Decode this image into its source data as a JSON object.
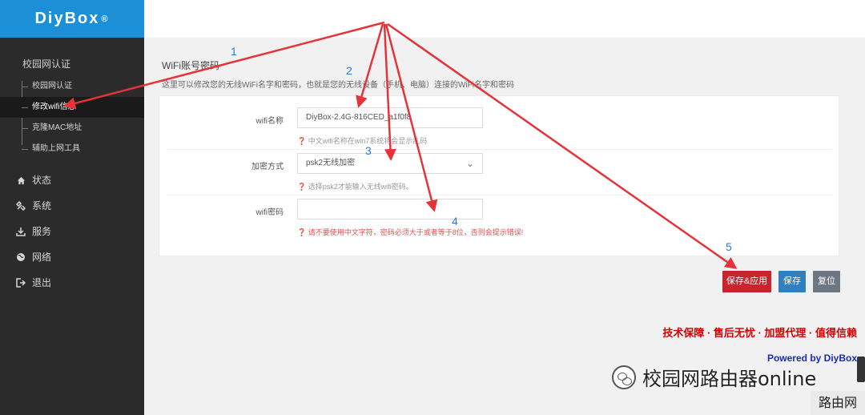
{
  "brand": {
    "name": "DiyBox",
    "mark": "®"
  },
  "sidebar": {
    "section_title": "校园网认证",
    "sub_items": [
      {
        "label": "校园网认证",
        "active": false
      },
      {
        "label": "修改wifi信息",
        "active": true
      },
      {
        "label": "克隆MAC地址",
        "active": false
      },
      {
        "label": "辅助上网工具",
        "active": false
      }
    ],
    "main_items": [
      {
        "label": "状态",
        "icon": "home-icon"
      },
      {
        "label": "系统",
        "icon": "tools-icon"
      },
      {
        "label": "服务",
        "icon": "download-icon"
      },
      {
        "label": "网络",
        "icon": "globe-icon"
      },
      {
        "label": "退出",
        "icon": "logout-icon"
      }
    ]
  },
  "main": {
    "title": "WiFi账号密码",
    "description": "这里可以修改您的无线WiFi名字和密码，也就是您的无线设备（手机、电脑）连接的WiFi名字和密码",
    "form": {
      "wifi_name": {
        "label": "wifi名称",
        "value": "DiyBox-2.4G-816CED_a1f0f8",
        "hint": "中文wifi名称在win7系统将会显示乱码"
      },
      "encryption": {
        "label": "加密方式",
        "value": "psk2无线加密",
        "hint": "选择psk2才能输入无线wifi密码。"
      },
      "wifi_password": {
        "label": "wifi密码",
        "value": "",
        "hint": "请不要使用中文字符，密码必须大于或者等于8位，否则会提示错误!"
      }
    },
    "buttons": {
      "apply": "保存&应用",
      "save": "保存",
      "reset": "复位"
    }
  },
  "footer": {
    "promo": "技术保障 · 售后无忧 · 加盟代理 · 值得信赖",
    "powered": "Powered by DiyBox"
  },
  "watermark": {
    "text": "校园网路由器online",
    "corner": "路由网"
  },
  "annotations": {
    "numbers": [
      "1",
      "2",
      "3",
      "4",
      "5"
    ],
    "number_color": "#2d7ad6",
    "arrow_color": "#e5333a"
  }
}
